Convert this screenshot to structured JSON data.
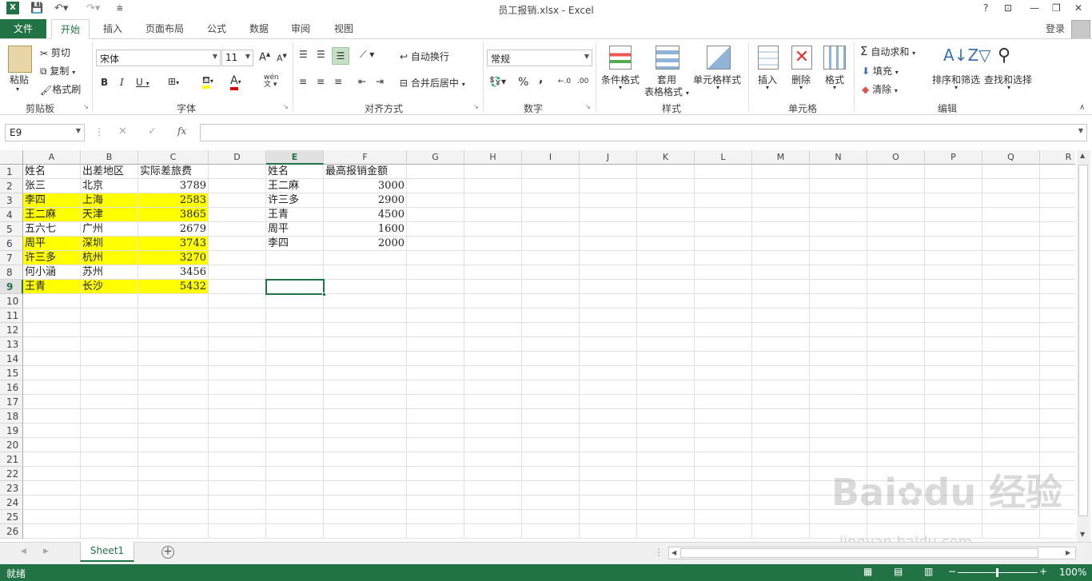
{
  "app": {
    "title": "员工报销.xlsx - Excel",
    "login": "登录"
  },
  "qat": {
    "help": "?"
  },
  "tabs": [
    {
      "label": "文件"
    },
    {
      "label": "开始"
    },
    {
      "label": "插入"
    },
    {
      "label": "页面布局"
    },
    {
      "label": "公式"
    },
    {
      "label": "数据"
    },
    {
      "label": "审阅"
    },
    {
      "label": "视图"
    }
  ],
  "ribbon": {
    "clipboard": {
      "paste": "粘贴",
      "cut": "剪切",
      "copy": "复制",
      "format_painter": "格式刷",
      "label": "剪贴板"
    },
    "font": {
      "name": "宋体",
      "size": "11",
      "bold": "B",
      "italic": "I",
      "underline": "U",
      "label": "字体",
      "grow": "A",
      "shrink": "A",
      "wen": "wén"
    },
    "alignment": {
      "wrap": "自动换行",
      "merge": "合并后居中",
      "label": "对齐方式"
    },
    "number": {
      "format": "常规",
      "label": "数字",
      "percent": "%",
      "comma": ",",
      "inc": "←.0",
      "dec": ".00"
    },
    "styles": {
      "conditional": "条件格式",
      "table1": "套用",
      "table2": "表格格式",
      "cell_styles": "单元格样式",
      "label": "样式"
    },
    "cells": {
      "insert": "插入",
      "delete": "删除",
      "format": "格式",
      "label": "单元格"
    },
    "editing": {
      "autosum": "自动求和",
      "fill": "填充",
      "clear": "清除",
      "sort": "排序和筛选",
      "find": "查找和选择",
      "label": "编辑"
    }
  },
  "formula_bar": {
    "name_box": "E9",
    "fx": "fx",
    "value": ""
  },
  "columns": [
    "A",
    "B",
    "C",
    "D",
    "E",
    "F",
    "G",
    "H",
    "I",
    "J",
    "K",
    "L",
    "M",
    "N",
    "O",
    "P",
    "Q",
    "R"
  ],
  "rows": [
    "1",
    "2",
    "3",
    "4",
    "5",
    "6",
    "7",
    "8",
    "9",
    "10",
    "11",
    "12",
    "13",
    "14",
    "15",
    "16",
    "17",
    "18",
    "19",
    "20",
    "21",
    "22",
    "23",
    "24",
    "25",
    "26"
  ],
  "table1": {
    "headers": [
      "姓名",
      "出差地区",
      "实际差旅费"
    ],
    "rows": [
      [
        "张三",
        "北京",
        "3789"
      ],
      [
        "李四",
        "上海",
        "2583"
      ],
      [
        "王二麻",
        "天津",
        "3865"
      ],
      [
        "五六七",
        "广州",
        "2679"
      ],
      [
        "周平",
        "深圳",
        "3743"
      ],
      [
        "许三多",
        "杭州",
        "3270"
      ],
      [
        "何小涵",
        "苏州",
        "3456"
      ],
      [
        "王青",
        "长沙",
        "5432"
      ]
    ],
    "highlight_color": "#ffff00"
  },
  "table2": {
    "headers": [
      "姓名",
      "最高报销金额"
    ],
    "rows": [
      [
        "王二麻",
        "3000"
      ],
      [
        "许三多",
        "2900"
      ],
      [
        "王青",
        "4500"
      ],
      [
        "周平",
        "1600"
      ],
      [
        "李四",
        "2000"
      ]
    ]
  },
  "sheet": {
    "name": "Sheet1"
  },
  "status": {
    "text": "就绪",
    "zoom": "100%"
  },
  "watermark": {
    "text": "Bai du 经验",
    "url": "jingyan.baidu.com"
  },
  "colors": {
    "accent": "#217346"
  }
}
